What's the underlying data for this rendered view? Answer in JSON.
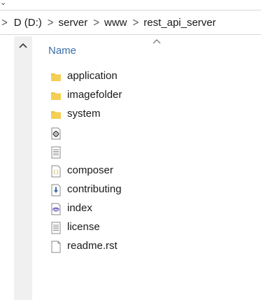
{
  "breadcrumb": {
    "items": [
      {
        "label": "D (D:)"
      },
      {
        "label": "server"
      },
      {
        "label": "www"
      },
      {
        "label": "rest_api_server"
      }
    ]
  },
  "column_header": {
    "name_label": "Name",
    "sort": "ascending"
  },
  "files": [
    {
      "label": "application",
      "icon": "folder-icon",
      "type": "folder"
    },
    {
      "label": "imagefolder",
      "icon": "folder-icon",
      "type": "folder"
    },
    {
      "label": "system",
      "icon": "folder-icon",
      "type": "folder"
    },
    {
      "label": "",
      "icon": "settings-file-icon",
      "type": "config"
    },
    {
      "label": "",
      "icon": "text-file-icon",
      "type": "text"
    },
    {
      "label": "composer",
      "icon": "json-file-icon",
      "type": "json"
    },
    {
      "label": "contributing",
      "icon": "download-file-icon",
      "type": "markdown"
    },
    {
      "label": "index",
      "icon": "php-file-icon",
      "type": "php"
    },
    {
      "label": "license",
      "icon": "text-file-icon",
      "type": "text"
    },
    {
      "label": "readme.rst",
      "icon": "blank-file-icon",
      "type": "rst"
    }
  ],
  "colors": {
    "folder": "#f0c33c",
    "folder_dark": "#dba828",
    "header_text": "#3c6ea8",
    "nav_pane": "#f0f0f0"
  }
}
